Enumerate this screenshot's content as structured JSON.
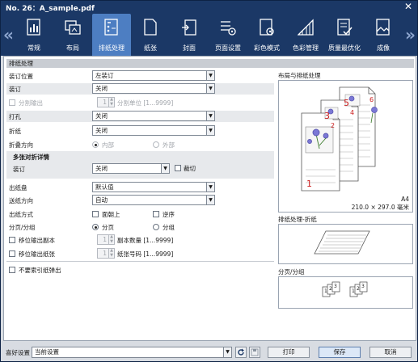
{
  "window": {
    "title": "No. 26：A_sample.pdf",
    "close_glyph": "✕"
  },
  "nav": {
    "prev": "«",
    "next": "»"
  },
  "tabs": [
    {
      "label": "常规",
      "icon": "general-icon"
    },
    {
      "label": "布局",
      "icon": "layout-icon"
    },
    {
      "label": "排纸处理",
      "icon": "finishing-icon",
      "active": true
    },
    {
      "label": "纸张",
      "icon": "paper-icon"
    },
    {
      "label": "封面",
      "icon": "cover-icon"
    },
    {
      "label": "页面设置",
      "icon": "page-setup-icon"
    },
    {
      "label": "彩色模式",
      "icon": "color-mode-icon"
    },
    {
      "label": "色彩管理",
      "icon": "color-management-icon"
    },
    {
      "label": "质量最优化",
      "icon": "quality-icon"
    },
    {
      "label": "成像",
      "icon": "imaging-icon"
    }
  ],
  "section_title": "排纸处理",
  "form": {
    "binding_position": {
      "label": "装订位置",
      "value": "左装订"
    },
    "staple": {
      "label": "装订",
      "value": "关闭"
    },
    "split_output": {
      "label": "分割输出",
      "value": "1",
      "unit": "分割单位 [1...9999]"
    },
    "punch": {
      "label": "打孔",
      "value": "关闭"
    },
    "fold": {
      "label": "折纸",
      "value": "关闭"
    },
    "fold_direction": {
      "label": "折叠方向",
      "inside": "内部",
      "outside": "外部"
    },
    "multi_fold_title": "多张对折详情",
    "multi_staple": {
      "label": "装订",
      "value": "关闭",
      "trim": "裁切"
    },
    "output_tray": {
      "label": "出纸盘",
      "value": "默认值"
    },
    "feed_direction": {
      "label": "送纸方向",
      "value": "自动"
    },
    "output_method": {
      "label": "出纸方式",
      "face_up": "面朝上",
      "reverse": "逆序"
    },
    "sort_group": {
      "label": "分页/分组",
      "sort": "分页",
      "group": "分组"
    },
    "offset_copies": {
      "label": "移位输出副本",
      "value": "1",
      "unit": "副本数量 [1...9999]"
    },
    "offset_sheets": {
      "label": "移位输出纸张",
      "value": "1",
      "unit": "纸张号码 [1...9999]"
    },
    "no_index_tab": {
      "label": "不要索引纸弹出"
    }
  },
  "preview": {
    "layout_title": "布局与排纸处理",
    "page_numbers": [
      "1",
      "2",
      "3",
      "4",
      "5",
      "6"
    ],
    "paper_size": "A4",
    "paper_dims": "210.0 × 297.0 毫米",
    "fold_title": "排纸处理-折纸",
    "sort_title": "分页/分组",
    "sort_digits": [
      "1",
      "2",
      "3"
    ]
  },
  "footer": {
    "favorite_label": "喜好设置",
    "favorite_value": "当前设置",
    "print": "打印",
    "save": "保存",
    "cancel": "取消"
  },
  "colors": {
    "title_bar": "#1b3866",
    "active_tab": "#4d7ec2",
    "page_number": "#cc1f1f"
  }
}
